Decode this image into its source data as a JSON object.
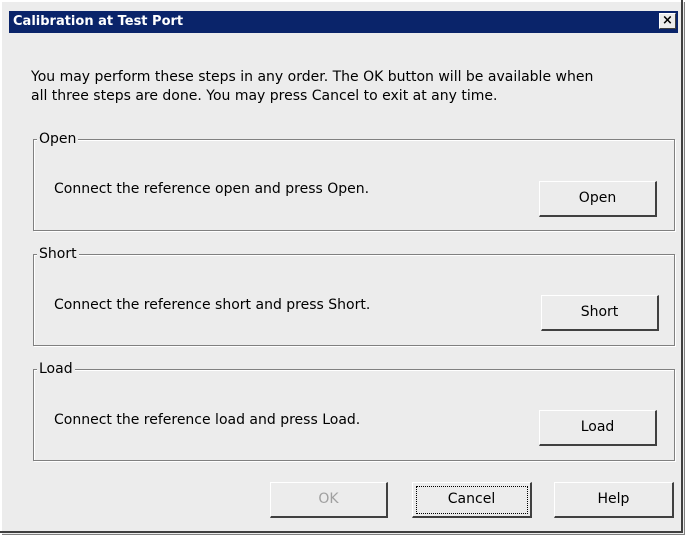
{
  "window": {
    "title": "Calibration at Test Port",
    "close_label": "×"
  },
  "intro_text": "You may perform these steps in any order. The OK button will be available when\nall three steps are done. You may press Cancel to exit at any time.",
  "groups": [
    {
      "title": "Open",
      "text": "Connect the reference open and press Open.",
      "button": "Open"
    },
    {
      "title": "Short",
      "text": "Connect the reference short and press Short.",
      "button": "Short"
    },
    {
      "title": "Load",
      "text": "Connect the reference load and press Load.",
      "button": "Load"
    }
  ],
  "footer": {
    "ok_label": "OK",
    "ok_enabled": false,
    "cancel_label": "Cancel",
    "help_label": "Help"
  }
}
